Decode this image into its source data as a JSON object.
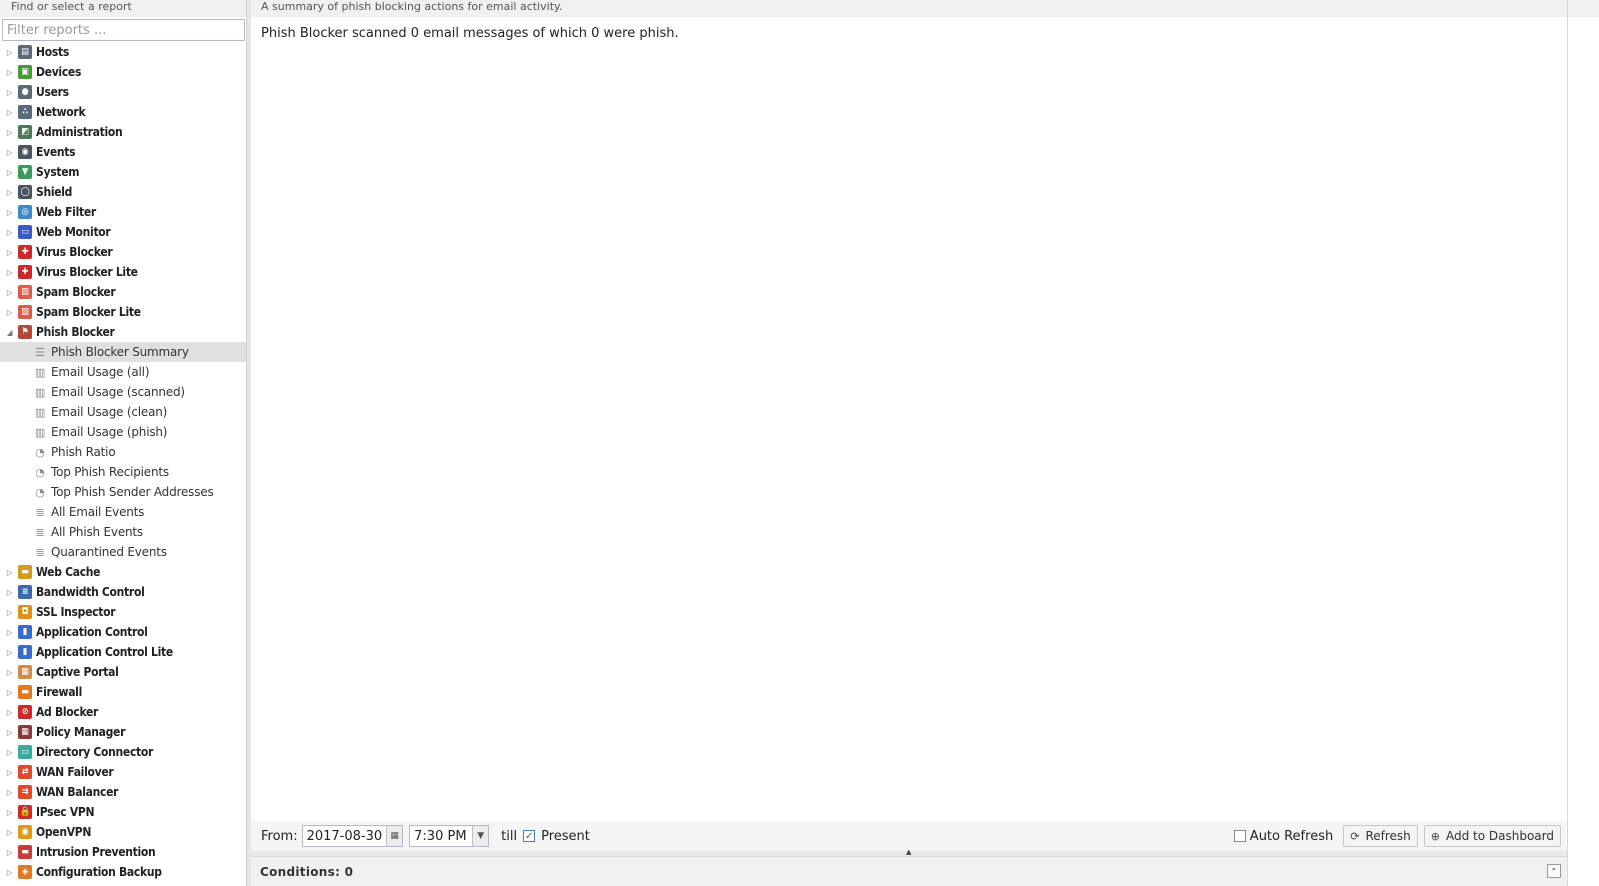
{
  "sidebar": {
    "header": "Find or select a report",
    "filter_placeholder": "Filter reports ...",
    "categories_before": [
      {
        "label": "Hosts",
        "icon": "hosts-icon",
        "color": "#5a6a7a",
        "glyph": "▤"
      },
      {
        "label": "Devices",
        "icon": "devices-icon",
        "color": "#4a9a3a",
        "glyph": "▣"
      },
      {
        "label": "Users",
        "icon": "users-icon",
        "color": "#5a6a7a",
        "glyph": "●"
      },
      {
        "label": "Network",
        "icon": "network-icon",
        "color": "#5a6a7a",
        "glyph": "∴"
      },
      {
        "label": "Administration",
        "icon": "administration-icon",
        "color": "#4a7a5a",
        "glyph": "◩"
      },
      {
        "label": "Events",
        "icon": "events-icon",
        "color": "#4a5560",
        "glyph": "◉"
      },
      {
        "label": "System",
        "icon": "system-icon",
        "color": "#3a9a5a",
        "glyph": "▼"
      },
      {
        "label": "Shield",
        "icon": "shield-icon",
        "color": "#4a5560",
        "glyph": "◯"
      },
      {
        "label": "Web Filter",
        "icon": "web-filter-icon",
        "color": "#3a8acc",
        "glyph": "◎"
      },
      {
        "label": "Web Monitor",
        "icon": "web-monitor-icon",
        "color": "#3a5acc",
        "glyph": "▭"
      },
      {
        "label": "Virus Blocker",
        "icon": "virus-blocker-icon",
        "color": "#cc2a2a",
        "glyph": "✚"
      },
      {
        "label": "Virus Blocker Lite",
        "icon": "virus-blocker-lite-icon",
        "color": "#cc2a2a",
        "glyph": "✚"
      },
      {
        "label": "Spam Blocker",
        "icon": "spam-blocker-icon",
        "color": "#e05a4a",
        "glyph": "▨"
      },
      {
        "label": "Spam Blocker Lite",
        "icon": "spam-blocker-lite-icon",
        "color": "#e05a4a",
        "glyph": "▨"
      }
    ],
    "expanded_category": {
      "label": "Phish Blocker",
      "icon": "phish-blocker-icon",
      "color": "#b04a3a",
      "glyph": "⚑"
    },
    "expanded_items": [
      {
        "label": "Phish Blocker Summary",
        "icon": "text-report-icon",
        "glyph": "☰",
        "selected": true
      },
      {
        "label": "Email Usage (all)",
        "icon": "bar-chart-icon",
        "glyph": "▥",
        "selected": false
      },
      {
        "label": "Email Usage (scanned)",
        "icon": "bar-chart-icon",
        "glyph": "▥",
        "selected": false
      },
      {
        "label": "Email Usage (clean)",
        "icon": "bar-chart-icon",
        "glyph": "▥",
        "selected": false
      },
      {
        "label": "Email Usage (phish)",
        "icon": "bar-chart-icon",
        "glyph": "▥",
        "selected": false
      },
      {
        "label": "Phish Ratio",
        "icon": "pie-chart-icon",
        "glyph": "◔",
        "selected": false
      },
      {
        "label": "Top Phish Recipients",
        "icon": "pie-chart-icon",
        "glyph": "◔",
        "selected": false
      },
      {
        "label": "Top Phish Sender Addresses",
        "icon": "pie-chart-icon",
        "glyph": "◔",
        "selected": false
      },
      {
        "label": "All Email Events",
        "icon": "list-icon",
        "glyph": "≣",
        "selected": false
      },
      {
        "label": "All Phish Events",
        "icon": "list-icon",
        "glyph": "≣",
        "selected": false
      },
      {
        "label": "Quarantined Events",
        "icon": "list-icon",
        "glyph": "≣",
        "selected": false
      }
    ],
    "categories_after": [
      {
        "label": "Web Cache",
        "icon": "web-cache-icon",
        "color": "#d49a1a",
        "glyph": "▬"
      },
      {
        "label": "Bandwidth Control",
        "icon": "bandwidth-control-icon",
        "color": "#3a6aaa",
        "glyph": "≡"
      },
      {
        "label": "SSL Inspector",
        "icon": "ssl-inspector-icon",
        "color": "#e0901a",
        "glyph": "◘"
      },
      {
        "label": "Application Control",
        "icon": "application-control-icon",
        "color": "#3a6acc",
        "glyph": "▮"
      },
      {
        "label": "Application Control Lite",
        "icon": "application-control-lite-icon",
        "color": "#3a6acc",
        "glyph": "▮"
      },
      {
        "label": "Captive Portal",
        "icon": "captive-portal-icon",
        "color": "#d08a4a",
        "glyph": "▦"
      },
      {
        "label": "Firewall",
        "icon": "firewall-icon",
        "color": "#e07a1a",
        "glyph": "▬"
      },
      {
        "label": "Ad Blocker",
        "icon": "ad-blocker-icon",
        "color": "#cc2a2a",
        "glyph": "⊘"
      },
      {
        "label": "Policy Manager",
        "icon": "policy-manager-icon",
        "color": "#8a3a3a",
        "glyph": "▦"
      },
      {
        "label": "Directory Connector",
        "icon": "directory-connector-icon",
        "color": "#3aaa9a",
        "glyph": "▭"
      },
      {
        "label": "WAN Failover",
        "icon": "wan-failover-icon",
        "color": "#e04a2a",
        "glyph": "⇄"
      },
      {
        "label": "WAN Balancer",
        "icon": "wan-balancer-icon",
        "color": "#e04a2a",
        "glyph": "⇉"
      },
      {
        "label": "IPsec VPN",
        "icon": "ipsec-vpn-icon",
        "color": "#cc2a2a",
        "glyph": "🔒"
      },
      {
        "label": "OpenVPN",
        "icon": "openvpn-icon",
        "color": "#e09a1a",
        "glyph": "◉"
      },
      {
        "label": "Intrusion Prevention",
        "icon": "intrusion-prevention-icon",
        "color": "#cc3a3a",
        "glyph": "▬"
      },
      {
        "label": "Configuration Backup",
        "icon": "configuration-backup-icon",
        "color": "#e07a2a",
        "glyph": "◈"
      }
    ]
  },
  "main": {
    "description": "A summary of phish blocking actions for email activity.",
    "summary": "Phish Blocker scanned 0 email messages of which 0 were phish."
  },
  "toolbar": {
    "from_label": "From:",
    "date_value": "2017-08-30",
    "time_value": "7:30 PM",
    "till_label": "till",
    "present_label": "Present",
    "present_checked": true,
    "auto_refresh_label": "Auto Refresh",
    "auto_refresh_checked": false,
    "refresh_label": "Refresh",
    "add_dashboard_label": "Add to Dashboard"
  },
  "conditions": {
    "label": "Conditions: 0"
  }
}
